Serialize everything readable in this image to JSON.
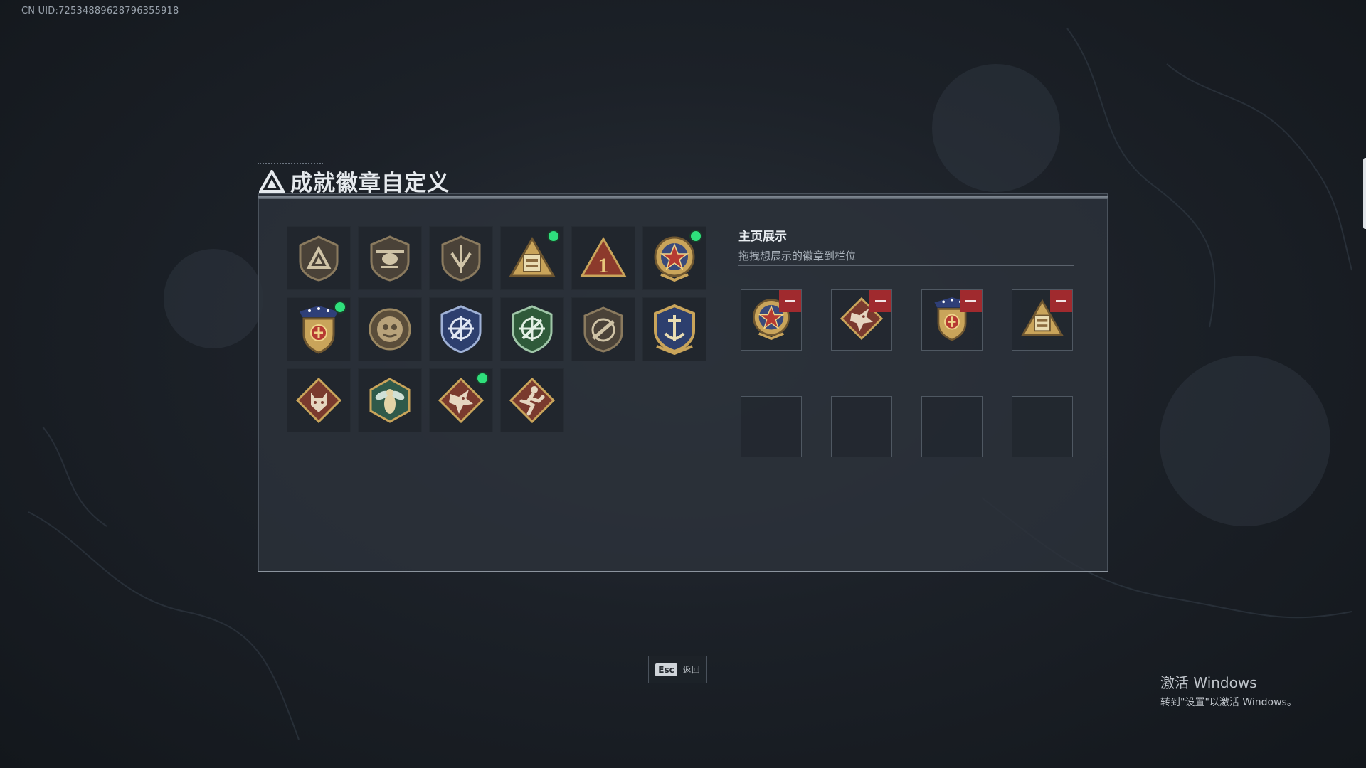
{
  "uid_text": "CN UID:725348896287963​55918",
  "header": {
    "title": "成就徽章自定义",
    "logo_icon": "triangle-logo-icon"
  },
  "badges": [
    {
      "icon": "shield-triangle-badge-icon",
      "new": false
    },
    {
      "icon": "helicopter-shield-badge-icon",
      "new": false
    },
    {
      "icon": "arrow-shield-badge-icon",
      "new": false
    },
    {
      "icon": "pyramid-crate-badge-icon",
      "new": true
    },
    {
      "icon": "number-one-triangle-badge-icon",
      "new": false,
      "label": "1"
    },
    {
      "icon": "star-medal-badge-icon",
      "new": true
    },
    {
      "icon": "stars-shield-medal-badge-icon",
      "new": true
    },
    {
      "icon": "emblem-round-badge-icon",
      "new": false
    },
    {
      "icon": "crosshair-blue-shield-badge-icon",
      "new": false
    },
    {
      "icon": "crosshair-green-shield-badge-icon",
      "new": false
    },
    {
      "icon": "rifle-shield-badge-icon",
      "new": false
    },
    {
      "icon": "anchor-gold-shield-badge-icon",
      "new": false
    },
    {
      "icon": "wolf-diamond-badge-icon",
      "new": false
    },
    {
      "icon": "wasp-hexagon-badge-icon",
      "new": false
    },
    {
      "icon": "dragon-diamond-badge-icon",
      "new": true
    },
    {
      "icon": "runner-diamond-badge-icon",
      "new": false
    }
  ],
  "showcase": {
    "title": "主页展示",
    "subtitle": "拖拽想展示的徽章到栏位",
    "filled_slots": [
      {
        "icon": "star-medal-badge-icon"
      },
      {
        "icon": "dragon-diamond-badge-icon"
      },
      {
        "icon": "stars-shield-medal-badge-icon"
      },
      {
        "icon": "pyramid-crate-badge-icon"
      }
    ],
    "empty_slot_count": 4,
    "remove_icon": "minus-icon"
  },
  "footer": {
    "esc_key": "Esc",
    "esc_label": "返回"
  },
  "windows_watermark": {
    "title": "激活 Windows",
    "subtitle": "转到\"设置\"以激活 Windows。"
  },
  "colors": {
    "new_dot": "#2fe07c",
    "remove": "#a02a2e",
    "panel": "#2c323a",
    "gold": "#c9a45a",
    "bronze": "#8a6a3e",
    "red_badge": "#8c3a2c"
  }
}
